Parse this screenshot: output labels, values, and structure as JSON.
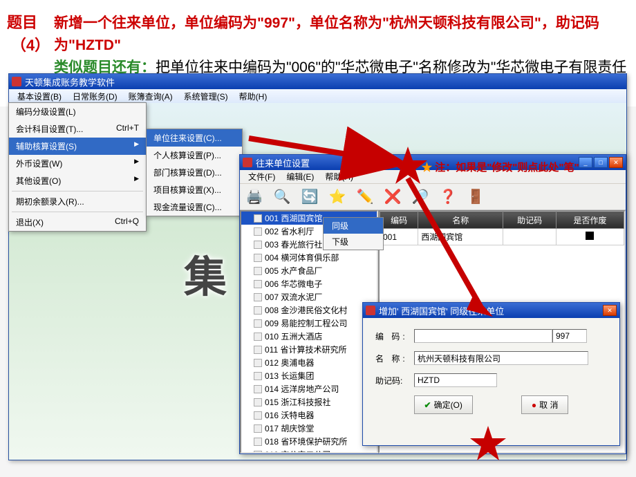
{
  "question": {
    "label": "题目",
    "number": "（4）",
    "main": "新增一个往来单位，单位编码为\"997\"，单位名称为\"杭州天顿科技有限公司\"，助记码为\"HZTD\"",
    "similar_label": "类似题目还有：",
    "similar": "把单位往来中编码为\"006\"的\"华芯微电子\"名称修改为\"华芯微电子有限责任公司\"编码不变。"
  },
  "mainWindow": {
    "title": "天顿集成账务教学软件",
    "menus": [
      "基本设置(B)",
      "日常账务(D)",
      "账簿查询(A)",
      "系统管理(S)",
      "帮助(H)"
    ]
  },
  "dropdown": {
    "items": [
      {
        "label": "编码分级设置(L)",
        "shortcut": ""
      },
      {
        "label": "会计科目设置(T)...",
        "shortcut": "Ctrl+T"
      },
      {
        "label": "辅助核算设置(S)",
        "shortcut": "",
        "arrow": true,
        "selected": true
      },
      {
        "label": "外币设置(W)",
        "shortcut": "",
        "arrow": true
      },
      {
        "label": "其他设置(O)",
        "shortcut": "",
        "arrow": true
      },
      {
        "label": "-sep-"
      },
      {
        "label": "期初余额录入(R)...",
        "shortcut": ""
      },
      {
        "label": "-sep-"
      },
      {
        "label": "退出(X)",
        "shortcut": "Ctrl+Q"
      }
    ]
  },
  "submenu": {
    "items": [
      {
        "label": "单位往来设置(C)...",
        "selected": true
      },
      {
        "label": "个人核算设置(P)..."
      },
      {
        "label": "部门核算设置(D)..."
      },
      {
        "label": "项目核算设置(X)..."
      },
      {
        "label": "现金流量设置(C)..."
      }
    ]
  },
  "childWindow": {
    "title": "往来单位设置",
    "menus": [
      "文件(F)",
      "编辑(E)",
      "帮助(H)"
    ],
    "toolbarIcons": [
      "🖨️",
      "🔍",
      "🔄",
      "⭐",
      "✏️",
      "❌",
      "🔎",
      "❓",
      "🚪"
    ],
    "tree": [
      {
        "code": "001",
        "name": "西湖国宾馆",
        "selected": true
      },
      {
        "code": "002",
        "name": "省水利厅"
      },
      {
        "code": "003",
        "name": "春光旅行社"
      },
      {
        "code": "004",
        "name": "横河体育俱乐部"
      },
      {
        "code": "005",
        "name": "水产食品厂"
      },
      {
        "code": "006",
        "name": "华芯微电子"
      },
      {
        "code": "007",
        "name": "双流水泥厂"
      },
      {
        "code": "008",
        "name": "金沙港民俗文化村"
      },
      {
        "code": "009",
        "name": "易能控制工程公司"
      },
      {
        "code": "010",
        "name": "五洲大酒店"
      },
      {
        "code": "011",
        "name": "省计算技术研究所"
      },
      {
        "code": "012",
        "name": "奥浦电器"
      },
      {
        "code": "013",
        "name": "长运集团"
      },
      {
        "code": "014",
        "name": "远洋房地产公司"
      },
      {
        "code": "015",
        "name": "浙江科技报社"
      },
      {
        "code": "016",
        "name": "沃特电器"
      },
      {
        "code": "017",
        "name": "胡庆馀堂"
      },
      {
        "code": "018",
        "name": "省环境保护研究所"
      },
      {
        "code": "019",
        "name": "市公交二公司"
      }
    ],
    "levelPopup": [
      "同级",
      "下级"
    ],
    "levelSelected": "同级",
    "table": {
      "headers": [
        "编码",
        "名称",
        "助记码",
        "是否作废"
      ],
      "row": {
        "code": "001",
        "name": "西湖国宾馆"
      }
    }
  },
  "dialog": {
    "title": "增加' 西湖国宾馆' 同级往来单位",
    "labels": {
      "code": "编 码:",
      "name": "名 称:",
      "mnemonic": "助记码:"
    },
    "values": {
      "code": "997",
      "name": "杭州天顿科技有限公司",
      "mnemonic": "HZTD"
    },
    "buttons": {
      "ok": "确定(O)",
      "cancel": "取 消"
    }
  },
  "annotation": "注：如果是\"修改\"则点此处\"笔\"",
  "bgText": "集"
}
